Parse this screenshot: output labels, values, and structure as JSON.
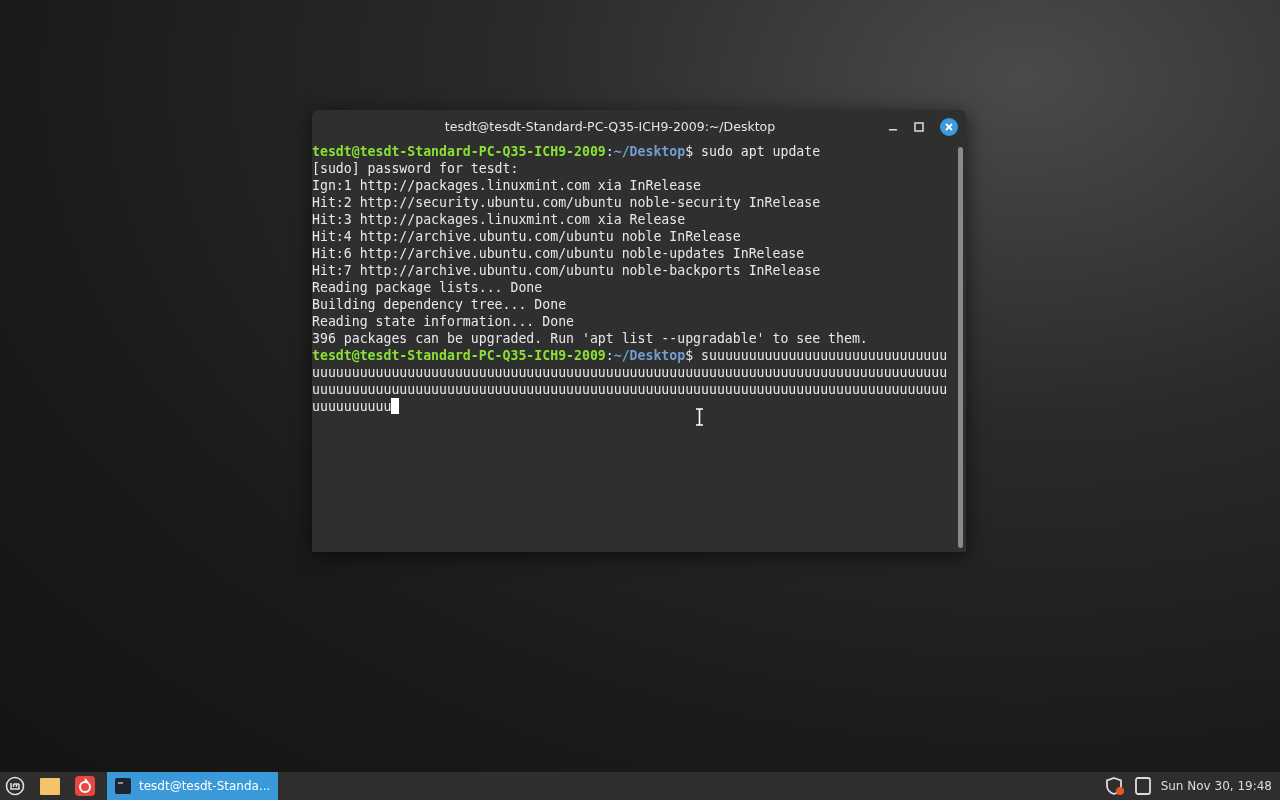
{
  "window": {
    "title": "tesdt@tesdt-Standard-PC-Q35-ICH9-2009:~/Desktop"
  },
  "terminal": {
    "lines": [
      {
        "kind": "prompt",
        "user_host": "tesdt@tesdt-Standard-PC-Q35-ICH9-2009",
        "colon": ":",
        "path": "~/Desktop",
        "command": "$ sudo apt update"
      },
      {
        "kind": "output",
        "text": "[sudo] password for tesdt:"
      },
      {
        "kind": "output",
        "text": "Ign:1 http://packages.linuxmint.com xia InRelease"
      },
      {
        "kind": "output",
        "text": "Hit:2 http://security.ubuntu.com/ubuntu noble-security InRelease"
      },
      {
        "kind": "output",
        "text": "Hit:3 http://packages.linuxmint.com xia Release"
      },
      {
        "kind": "output",
        "text": "Hit:4 http://archive.ubuntu.com/ubuntu noble InRelease"
      },
      {
        "kind": "output",
        "text": "Hit:6 http://archive.ubuntu.com/ubuntu noble-updates InRelease"
      },
      {
        "kind": "output",
        "text": "Hit:7 http://archive.ubuntu.com/ubuntu noble-backports InRelease"
      },
      {
        "kind": "output",
        "text": "Reading package lists... Done"
      },
      {
        "kind": "output",
        "text": "Building dependency tree... Done"
      },
      {
        "kind": "output",
        "text": "Reading state information... Done"
      },
      {
        "kind": "output",
        "text": "396 packages can be upgraded. Run 'apt list --upgradable' to see them."
      },
      {
        "kind": "prompt",
        "user_host": "tesdt@tesdt-Standard-PC-Q35-ICH9-2009",
        "colon": ":",
        "path": "~/Desktop",
        "command": "$ suuuuuuuuuuuuuuuuuuuuuuuuuuuuuu"
      },
      {
        "kind": "output",
        "text": "uuuuuuuuuuuuuuuuuuuuuuuuuuuuuuuuuuuuuuuuuuuuuuuuuuuuuuuuuuuuuuuuuuuuuuuuuuuuuuuu"
      },
      {
        "kind": "output",
        "text": "uuuuuuuuuuuuuuuuuuuuuuuuuuuuuuuuuuuuuuuuuuuuuuuuuuuuuuuuuuuuuuuuuuuuuuuuuuuuuuuu"
      },
      {
        "kind": "input",
        "text": "uuuuuuuuuu"
      }
    ]
  },
  "taskbar": {
    "window_button": {
      "label": "tesdt@tesdt-Standa...",
      "selected": true
    },
    "clock": "Sun Nov 30, 19:48"
  }
}
